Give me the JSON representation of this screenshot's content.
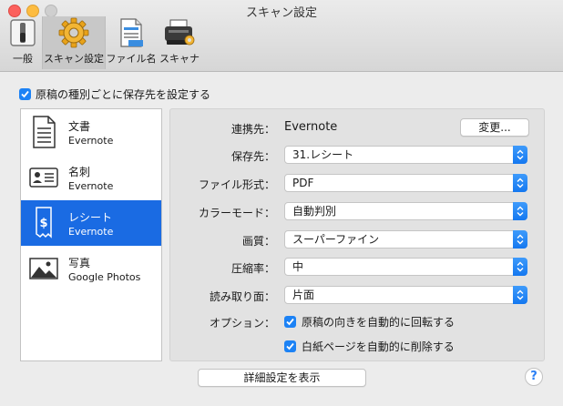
{
  "window": {
    "title": "スキャン設定"
  },
  "toolbar": {
    "items": [
      {
        "label": "一般",
        "icon": "switch-icon"
      },
      {
        "label": "スキャン設定",
        "icon": "gear-icon"
      },
      {
        "label": "ファイル名",
        "icon": "file-name-icon"
      },
      {
        "label": "スキャナ",
        "icon": "scanner-icon"
      }
    ],
    "selected": "スキャン設定"
  },
  "top_option": {
    "label": "原稿の種別ごとに保存先を設定する",
    "checked": true
  },
  "doc_types": [
    {
      "name": "文書",
      "destination": "Evernote",
      "icon": "document-icon"
    },
    {
      "name": "名刺",
      "destination": "Evernote",
      "icon": "business-card-icon"
    },
    {
      "name": "レシート",
      "destination": "Evernote",
      "icon": "receipt-icon",
      "selected": true
    },
    {
      "name": "写真",
      "destination": "Google Photos",
      "icon": "photo-icon"
    }
  ],
  "settings": {
    "link_label": "連携先：",
    "link_value": "Evernote",
    "change_button": "変更...",
    "save_to_label": "保存先：",
    "save_to_value": "31.レシート",
    "format_label": "ファイル形式：",
    "format_value": "PDF",
    "color_label": "カラーモード：",
    "color_value": "自動判別",
    "quality_label": "画質：",
    "quality_value": "スーパーファイン",
    "compression_label": "圧縮率：",
    "compression_value": "中",
    "side_label": "読み取り面：",
    "side_value": "片面",
    "options_label": "オプション：",
    "option_rotate": "原稿の向きを自動的に回転する",
    "option_blank": "白紙ページを自動的に削除する"
  },
  "footer": {
    "details_button": "詳細設定を表示",
    "help": "?"
  },
  "colors": {
    "accent": "#1a6be3",
    "checkbox": "#1c82f5"
  }
}
